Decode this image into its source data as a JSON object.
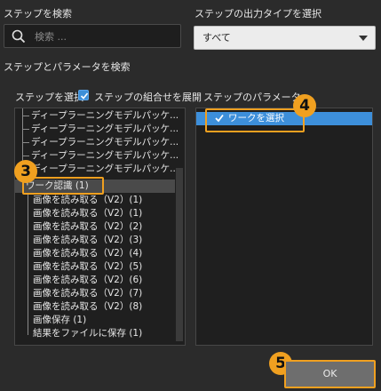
{
  "search": {
    "label": "ステップを検索",
    "placeholder": "検索 ..."
  },
  "output_type": {
    "label": "ステップの出力タイプを選択",
    "selected": "すべて"
  },
  "step_param_search": {
    "label": "ステップとパラメータを検索"
  },
  "step_select": {
    "label": "ステップを選択",
    "expand_label": "ステップの組合せを展開",
    "expand_checked": true
  },
  "param_panel": {
    "label": "ステップのパラメータ",
    "items": [
      {
        "label": "ワークを選択",
        "checked": true
      }
    ]
  },
  "tree": {
    "items": [
      {
        "label": "ディープラーニングモデルパッケ..."
      },
      {
        "label": "ディープラーニングモデルパッケ..."
      },
      {
        "label": "ディープラーニングモデルパッケ..."
      },
      {
        "label": "ディープラーニングモデルパッケ..."
      },
      {
        "label": "ディープラーニングモデルパッケ..."
      },
      {
        "label": "ワーク認識 (1)",
        "selected": true
      },
      {
        "label": "画像を読み取る（V2）(1)"
      },
      {
        "label": "画像を読み取る（V2）(1)"
      },
      {
        "label": "画像を読み取る（V2）(2)"
      },
      {
        "label": "画像を読み取る（V2）(3)"
      },
      {
        "label": "画像を読み取る（V2）(4)"
      },
      {
        "label": "画像を読み取る（V2）(5)"
      },
      {
        "label": "画像を読み取る（V2）(6)"
      },
      {
        "label": "画像を読み取る（V2）(7)"
      },
      {
        "label": "画像を読み取る（V2）(8)"
      },
      {
        "label": "画像保存 (1)"
      },
      {
        "label": "結果をファイルに保存 (1)"
      }
    ]
  },
  "badges": {
    "b3": "3",
    "b4": "4",
    "b5": "5"
  },
  "ok_button": {
    "label": "OK"
  },
  "colors": {
    "accent": "#3d8fda",
    "highlight": "#f0a020",
    "background": "#2b2b2b",
    "panel": "#1f1f1f"
  }
}
